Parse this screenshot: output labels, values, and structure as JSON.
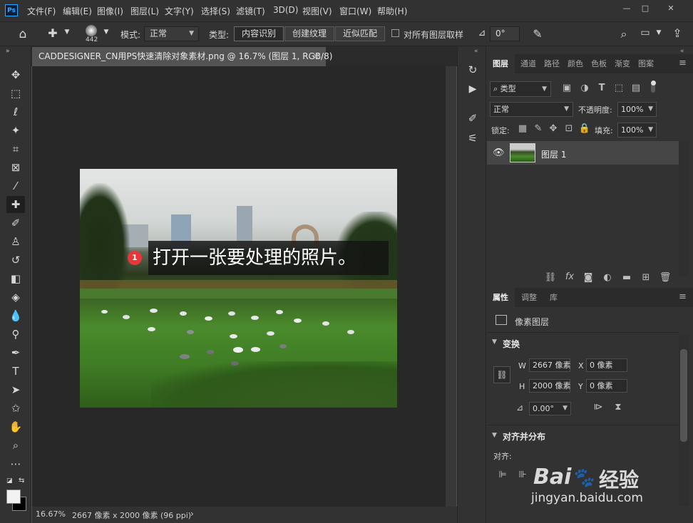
{
  "menubar": {
    "logo": "Ps",
    "items": [
      "文件(F)",
      "编辑(E)",
      "图像(I)",
      "图层(L)",
      "文字(Y)",
      "选择(S)",
      "滤镜(T)",
      "3D(D)",
      "视图(V)",
      "窗口(W)",
      "帮助(H)"
    ],
    "minimize": "—",
    "maximize": "□",
    "close": "✕"
  },
  "options": {
    "brush_size": "442",
    "mode_label": "模式:",
    "mode_value": "正常",
    "type_label": "类型:",
    "type_buttons": [
      "内容识别",
      "创建纹理",
      "近似匹配"
    ],
    "sample_all_label": "对所有图层取样",
    "angle_value": "0°"
  },
  "document": {
    "tab_title": "CADDESIGNER_CN用PS快速清除对象素材.png @ 16.7% (图层 1, RGB/8)",
    "tab_close": "×"
  },
  "annotation": {
    "badge": "1",
    "text": "打开一张要处理的照片。"
  },
  "status": {
    "zoom": "16.67%",
    "info": "2667 像素 x 2000 像素 (96 ppi)",
    "arrow": "›"
  },
  "layers_panel": {
    "tabs": [
      "图层",
      "通道",
      "路径",
      "颜色",
      "色板",
      "渐变",
      "图案"
    ],
    "filter_kind": "类型",
    "blend_mode": "正常",
    "opacity_label": "不透明度:",
    "opacity_value": "100%",
    "lock_label": "锁定:",
    "fill_label": "填充:",
    "fill_value": "100%",
    "layer_name": "图层 1"
  },
  "properties_panel": {
    "tabs": [
      "属性",
      "调整",
      "库"
    ],
    "pixel_layer": "像素图层",
    "transform_title": "变换",
    "w_label": "W",
    "w_value": "2667 像素",
    "x_label": "X",
    "x_value": "0 像素",
    "h_label": "H",
    "h_value": "2000 像素",
    "y_label": "Y",
    "y_value": "0 像素",
    "rotate_value": "0.00°",
    "align_title": "对齐并分布",
    "align_label": "对齐:"
  },
  "watermark": {
    "brand_a": "Bai",
    "brand_b": "经验",
    "url": "jingyan.baidu.com"
  }
}
